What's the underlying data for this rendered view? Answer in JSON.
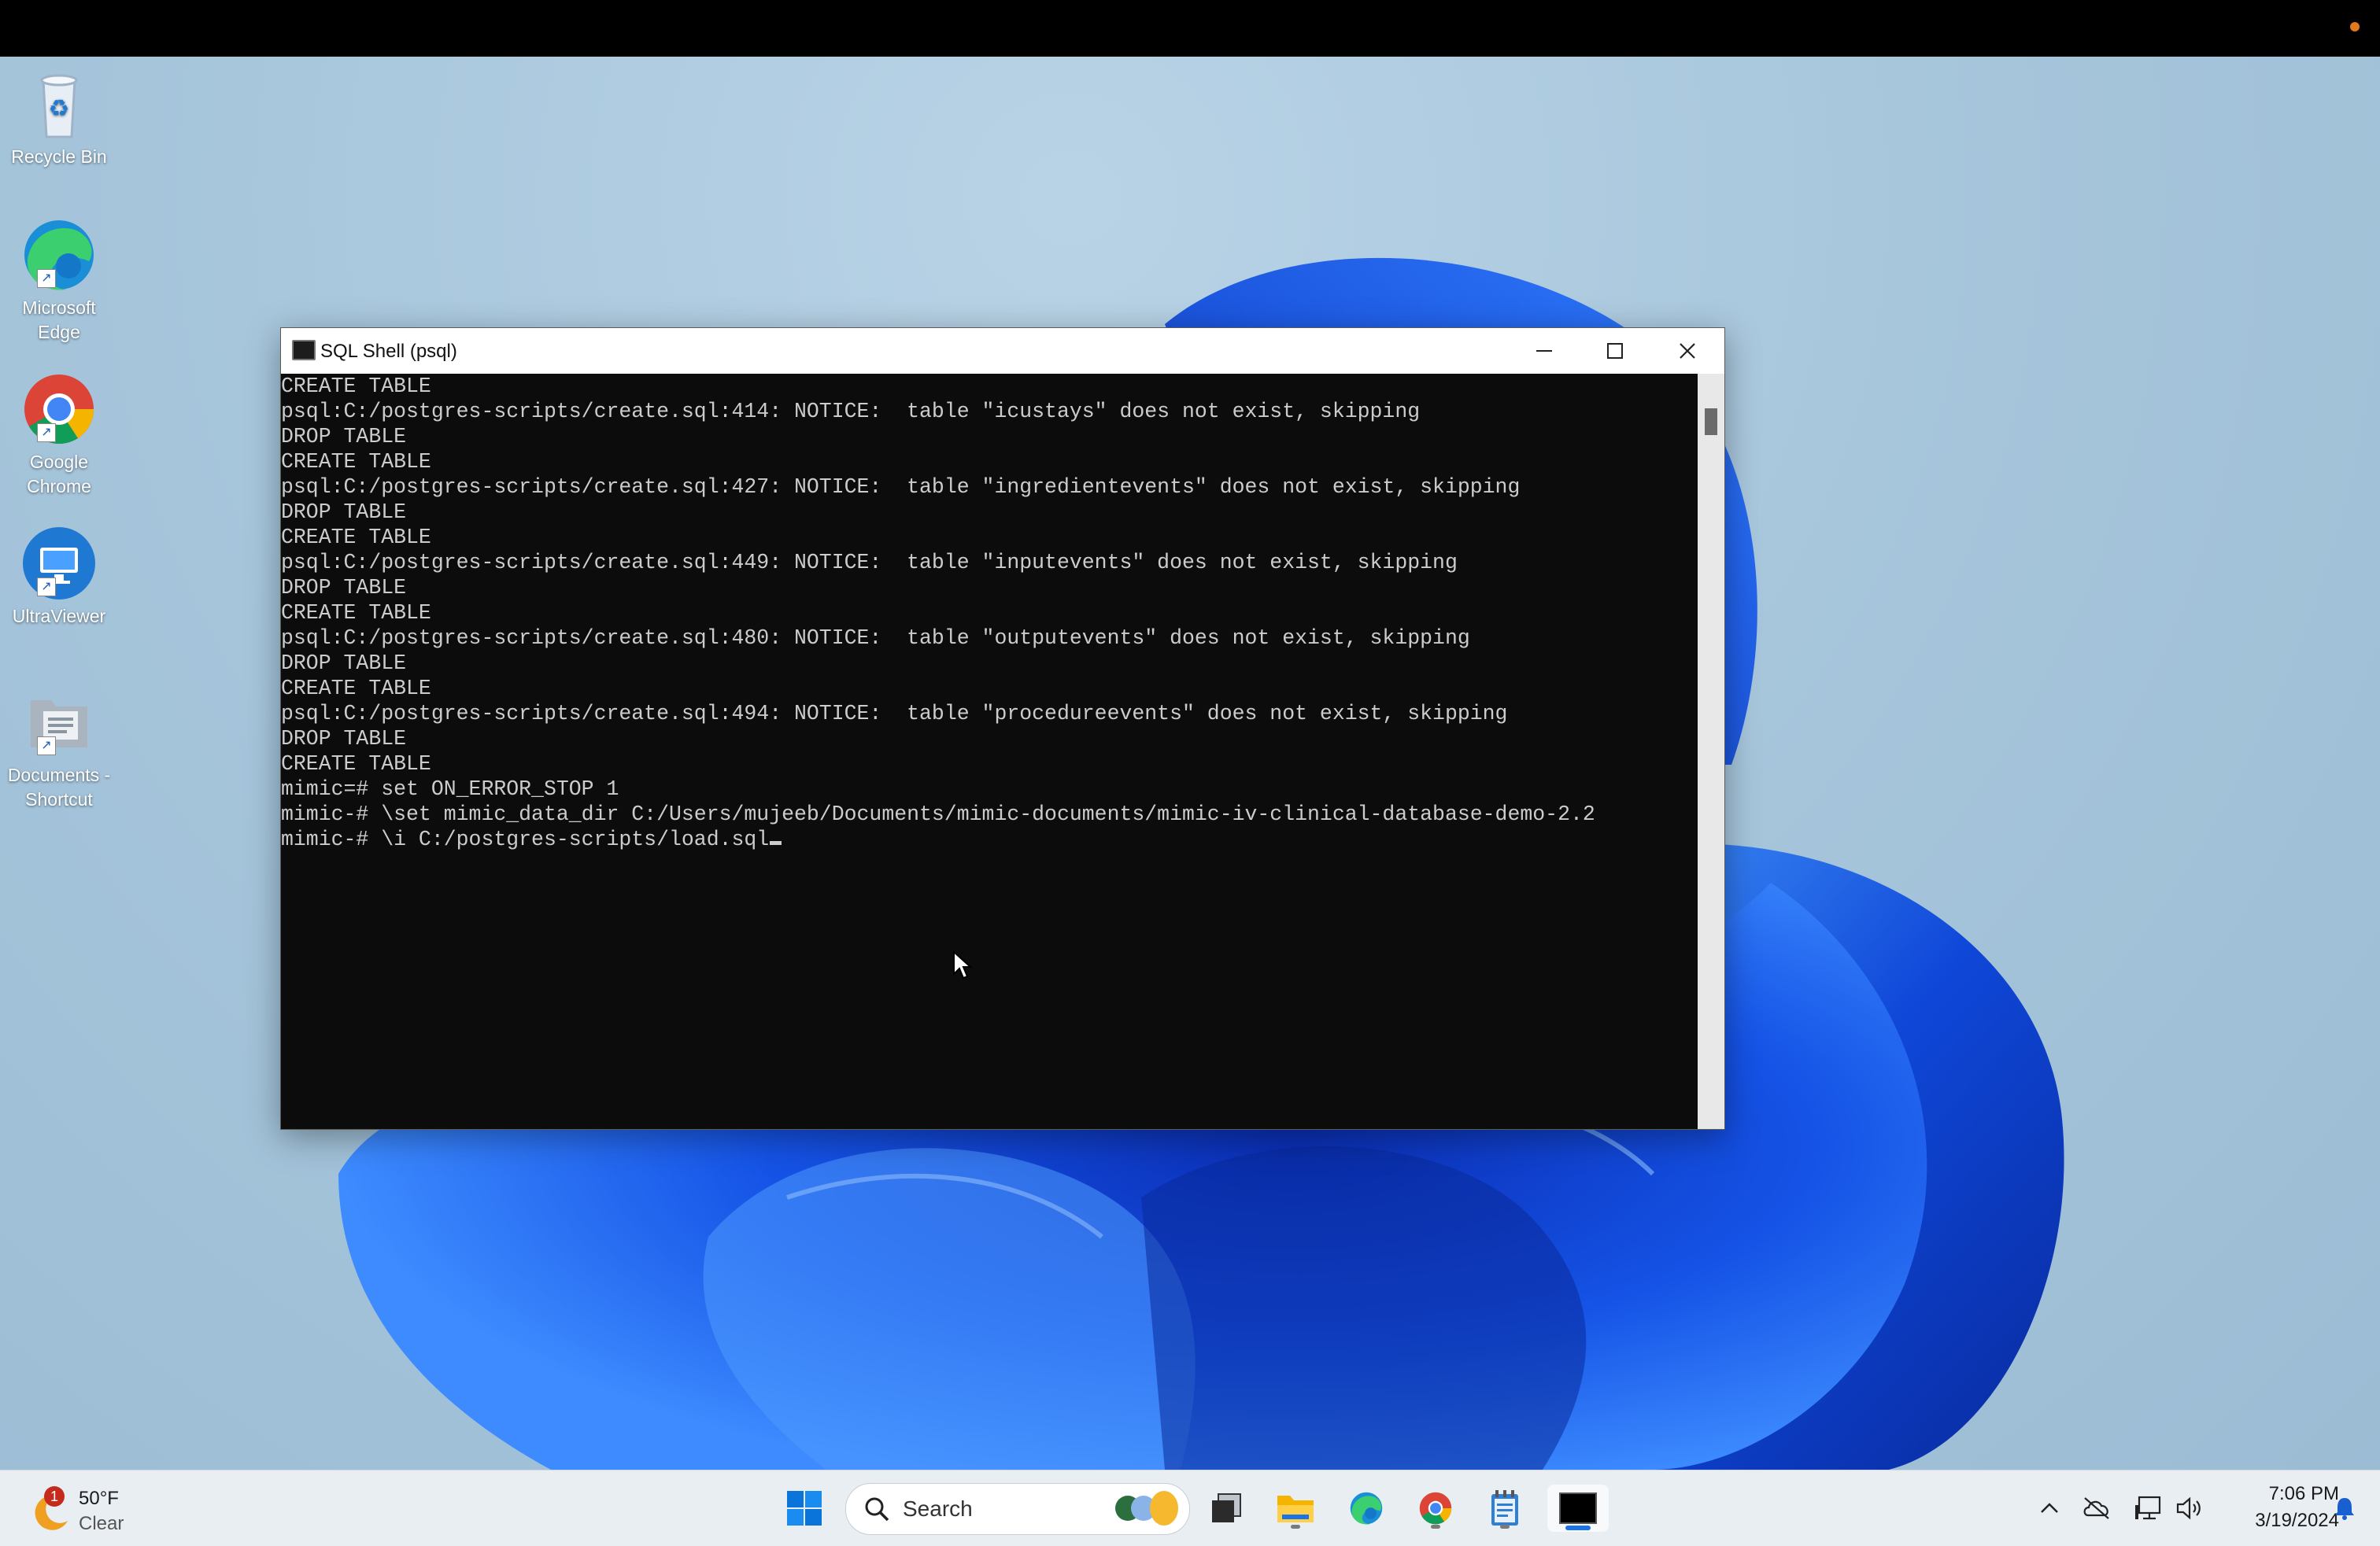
{
  "desktop": {
    "icons": [
      {
        "label": "Recycle Bin"
      },
      {
        "label": "Microsoft\nEdge"
      },
      {
        "label": "Google\nChrome"
      },
      {
        "label": "UltraViewer"
      },
      {
        "label": "Documents -\nShortcut"
      }
    ]
  },
  "window": {
    "title": "SQL Shell (psql)",
    "console_lines": [
      "CREATE TABLE",
      "psql:C:/postgres-scripts/create.sql:414: NOTICE:  table \"icustays\" does not exist, skipping",
      "DROP TABLE",
      "CREATE TABLE",
      "psql:C:/postgres-scripts/create.sql:427: NOTICE:  table \"ingredientevents\" does not exist, skipping",
      "DROP TABLE",
      "CREATE TABLE",
      "psql:C:/postgres-scripts/create.sql:449: NOTICE:  table \"inputevents\" does not exist, skipping",
      "DROP TABLE",
      "CREATE TABLE",
      "psql:C:/postgres-scripts/create.sql:480: NOTICE:  table \"outputevents\" does not exist, skipping",
      "DROP TABLE",
      "CREATE TABLE",
      "psql:C:/postgres-scripts/create.sql:494: NOTICE:  table \"procedureevents\" does not exist, skipping",
      "DROP TABLE",
      "CREATE TABLE",
      "mimic=# set ON_ERROR_STOP 1",
      "mimic-# \\set mimic_data_dir C:/Users/mujeeb/Documents/mimic-documents/mimic-iv-clinical-database-demo-2.2",
      "mimic-# \\i C:/postgres-scripts/load.sql"
    ]
  },
  "taskbar": {
    "weather": {
      "temp": "50°F",
      "condition": "Clear",
      "badge": "1"
    },
    "search_label": "Search",
    "clock": {
      "time": "7:06 PM",
      "date": "3/19/2024"
    }
  },
  "colors": {
    "console_bg": "#0c0c0c",
    "console_text": "#cccccc",
    "accent": "#1a73e8"
  }
}
